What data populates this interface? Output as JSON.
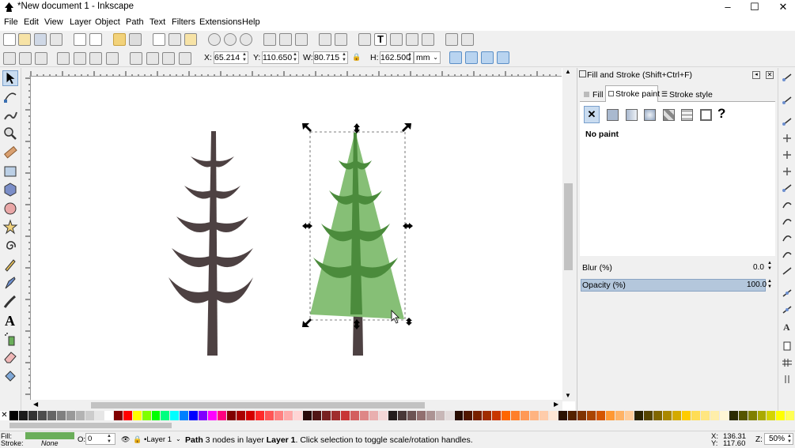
{
  "window": {
    "title": "*New document 1 - Inkscape",
    "minimize": "–",
    "maximize": "☐",
    "close": "✕"
  },
  "menu": [
    "File",
    "Edit",
    "View",
    "Layer",
    "Object",
    "Path",
    "Text",
    "Filters",
    "Extensions",
    "Help"
  ],
  "controls": {
    "x_label": "X:",
    "x_value": "65.214",
    "y_label": "Y:",
    "y_value": "110.650",
    "w_label": "W:",
    "w_value": "80.715",
    "h_label": "H:",
    "h_value": "162.500",
    "unit": "mm"
  },
  "panel": {
    "title": "Fill and Stroke (Shift+Ctrl+F)",
    "tabs": [
      "Fill",
      "Stroke paint",
      "Stroke style"
    ],
    "paint_status": "No paint",
    "blur_label": "Blur (%)",
    "blur_value": "0.0",
    "opacity_label": "Opacity (%)",
    "opacity_value": "100.0"
  },
  "status": {
    "fill_label": "Fill:",
    "stroke_label": "Stroke:",
    "stroke_value": "None",
    "fill_color": "#6aae5a",
    "opacity_label": "O:",
    "opacity_value": "0",
    "layer": "•Layer 1",
    "message_path": "Path",
    "message_rest": " 3 nodes in layer ",
    "message_layer": "Layer 1",
    "message_end": ". Click selection to toggle scale/rotation handles.",
    "x_label": "X:",
    "x_value": "136.31",
    "y_label": "Y:",
    "y_value": "117.60",
    "zoom_label": "Z:",
    "zoom_value": "50%"
  },
  "colors": {
    "trunk": "#4d4142",
    "tree_light": "#86bf76",
    "tree_dark": "#4b8b3c",
    "selection_dash": "#555555"
  },
  "palette": [
    "#000000",
    "#1a1a1a",
    "#333333",
    "#4d4d4d",
    "#666666",
    "#808080",
    "#999999",
    "#b3b3b3",
    "#cccccc",
    "#e6e6e6",
    "#ffffff",
    "#800000",
    "#ff0000",
    "#ffff00",
    "#80ff00",
    "#00ff00",
    "#00ff80",
    "#00ffff",
    "#0080ff",
    "#0000ff",
    "#8000ff",
    "#ff00ff",
    "#ff0080",
    "#800000",
    "#aa0000",
    "#d40000",
    "#ff2a2a",
    "#ff5555",
    "#ff8080",
    "#ffaaaa",
    "#ffd5d5",
    "#280b0b",
    "#501616",
    "#782121",
    "#a02c2c",
    "#c83737",
    "#d35f5f",
    "#de8787",
    "#e9afaf",
    "#f4d7d7",
    "#241c1c",
    "#483737",
    "#6c5353",
    "#916f6f",
    "#ac9393",
    "#c8b7b7",
    "#e3dbdb",
    "#280b00",
    "#501600",
    "#782100",
    "#a02c00",
    "#c83700",
    "#ff6600",
    "#ff7f2a",
    "#ff9955",
    "#ffb380",
    "#ffccaa",
    "#ffe6d5",
    "#2b1100",
    "#552200",
    "#803300",
    "#aa4400",
    "#d45500",
    "#ff9933",
    "#ffb366",
    "#ffcc99",
    "#2b2200",
    "#554400",
    "#806600",
    "#aa8800",
    "#d4aa00",
    "#ffcc00",
    "#ffdd55",
    "#ffe680",
    "#ffeeaa",
    "#fff6d5",
    "#2b2b00",
    "#555500",
    "#808000",
    "#aaaa00",
    "#d4d400",
    "#ffff00",
    "#ffff55"
  ]
}
